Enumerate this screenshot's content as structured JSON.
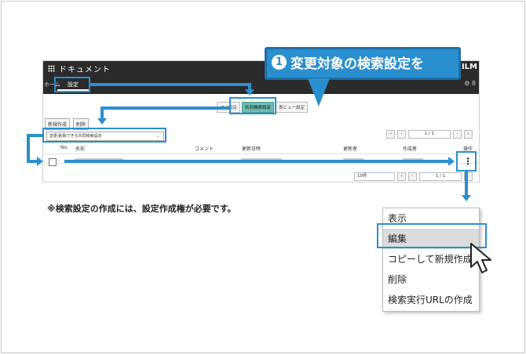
{
  "app": {
    "title": "ドキュメント",
    "brand": "ILM",
    "breadcrumb": "ホーム",
    "settings_tab": "設定",
    "header_icons": "⚙ 8",
    "subtabs": [
      "マイ設定",
      "共同検索設定",
      "表ビュー設定"
    ],
    "buttons": [
      "新規作成",
      "削除"
    ],
    "filter_value": "変更/削除できる共同検索設定",
    "pager_text": "1 / 1",
    "per_page": "10件",
    "table_headers": [
      "No.",
      "名前",
      "コメント",
      "更新日時",
      "更新者",
      "作成者",
      "操作"
    ]
  },
  "callout": {
    "step": "1",
    "text": "変更対象の検索設定を"
  },
  "note": "※検索設定の作成には、設定作成権が必要です。",
  "context_menu": {
    "items": [
      "表示",
      "編集",
      "コピーして新規作成",
      "削除",
      "検索実行URLの作成"
    ],
    "selected": "編集"
  },
  "colors": {
    "accent": "#2a8fcf",
    "header": "#2b2b2b",
    "active_subtab": "#6cbcb0"
  }
}
